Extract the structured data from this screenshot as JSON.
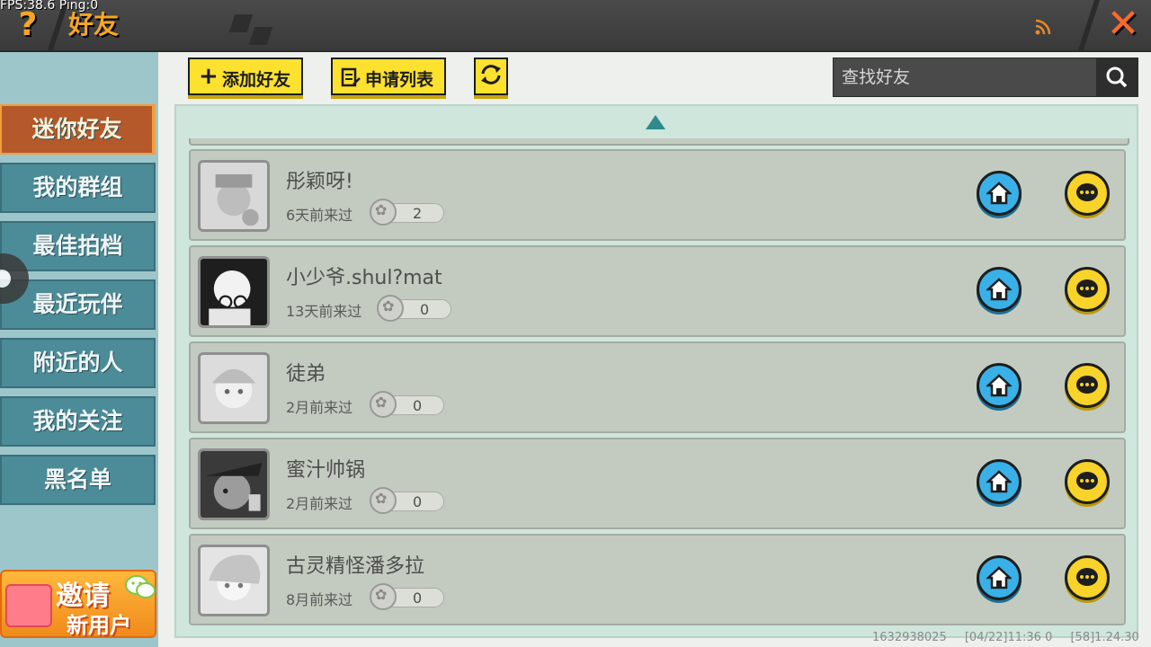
{
  "hud": {
    "fps": "FPS:38.6  Ping:0"
  },
  "header": {
    "help_label": "?",
    "title": "好友",
    "close_label": "✕"
  },
  "sidebar": {
    "items": [
      {
        "label": "迷你好友",
        "active": true
      },
      {
        "label": "我的群组"
      },
      {
        "label": "最佳拍档"
      },
      {
        "label": "最近玩伴"
      },
      {
        "label": "附近的人"
      },
      {
        "label": "我的关注"
      },
      {
        "label": "黑名单"
      }
    ],
    "invite": {
      "line1": "邀请",
      "line2": "新用户"
    }
  },
  "toolbar": {
    "add_friend_label": "添加好友",
    "apply_list_label": "申请列表",
    "search_placeholder": "查找好友"
  },
  "friends": [
    {
      "name": "彤颖呀!",
      "last_seen": "6天前来过",
      "score": "2"
    },
    {
      "name": "小少爷.shul?mat",
      "last_seen": "13天前来过",
      "score": "0"
    },
    {
      "name": "徒弟",
      "last_seen": "2月前来过",
      "score": "0"
    },
    {
      "name": "蜜汁帅锅",
      "last_seen": "2月前来过",
      "score": "0"
    },
    {
      "name": "古灵精怪潘多拉",
      "last_seen": "8月前来过",
      "score": "0"
    }
  ],
  "footer": {
    "uid": "1632938025",
    "time": "[04/22]11:36 0",
    "version": "[58]1.24.30"
  },
  "colors": {
    "accent_orange": "#f6a623",
    "home_blue": "#3ab0e8",
    "chat_yellow": "#f8d32a",
    "sidebar_teal": "#4c8b98"
  }
}
